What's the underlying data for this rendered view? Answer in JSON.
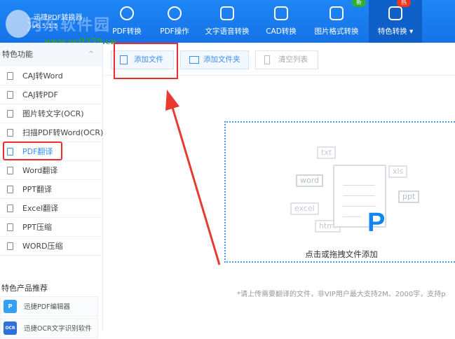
{
  "app": {
    "name": "迅捷PDF转换器",
    "version": "v6.5.1.5",
    "watermark": "河东软件园",
    "watermark_url": "www.pc0359.cn"
  },
  "tabs": [
    {
      "label": "PDF转换",
      "icon": "pdf-convert-icon"
    },
    {
      "label": "PDF操作",
      "icon": "pdf-operate-icon"
    },
    {
      "label": "文字语音转换",
      "icon": "voice-icon"
    },
    {
      "label": "CAD转换",
      "icon": "cad-icon"
    },
    {
      "label": "图片格式转换",
      "icon": "image-icon",
      "badge": "新",
      "badge_color": "#2fb12f"
    },
    {
      "label": "特色转换 ▾",
      "icon": "star-icon",
      "badge": "热",
      "badge_color": "#f0361e",
      "active": true
    }
  ],
  "sidebar": {
    "section": "特色功能",
    "items": [
      "CAJ转Word",
      "CAJ转PDF",
      "图片转文字(OCR)",
      "扫描PDF转Word(OCR)",
      "PDF翻译",
      "Word翻译",
      "PPT翻译",
      "Excel翻译",
      "PPT压缩",
      "WORD压缩"
    ],
    "selected": 4,
    "recommend_title": "特色产品推荐",
    "products": [
      {
        "label": "迅捷PDF编辑器",
        "icon_text": "P"
      },
      {
        "label": "迅捷OCR文字识别软件",
        "icon_text": "OCR"
      }
    ]
  },
  "toolbar": {
    "add_file": "添加文件",
    "add_folder": "添加文件夹",
    "clear_list": "清空列表"
  },
  "dropzone": {
    "tags": [
      "txt",
      "xls",
      "word",
      "ppt",
      "excel",
      "html"
    ],
    "prompt": "点击或拖拽文件添加",
    "logo": "P"
  },
  "note": "*请上传需要翻译的文件，非VIP用户最大支持2M、2000字，支持p",
  "colors": {
    "header": "#1a7cf0",
    "accent": "#3a8ef0",
    "highlight": "#f02b2b"
  }
}
